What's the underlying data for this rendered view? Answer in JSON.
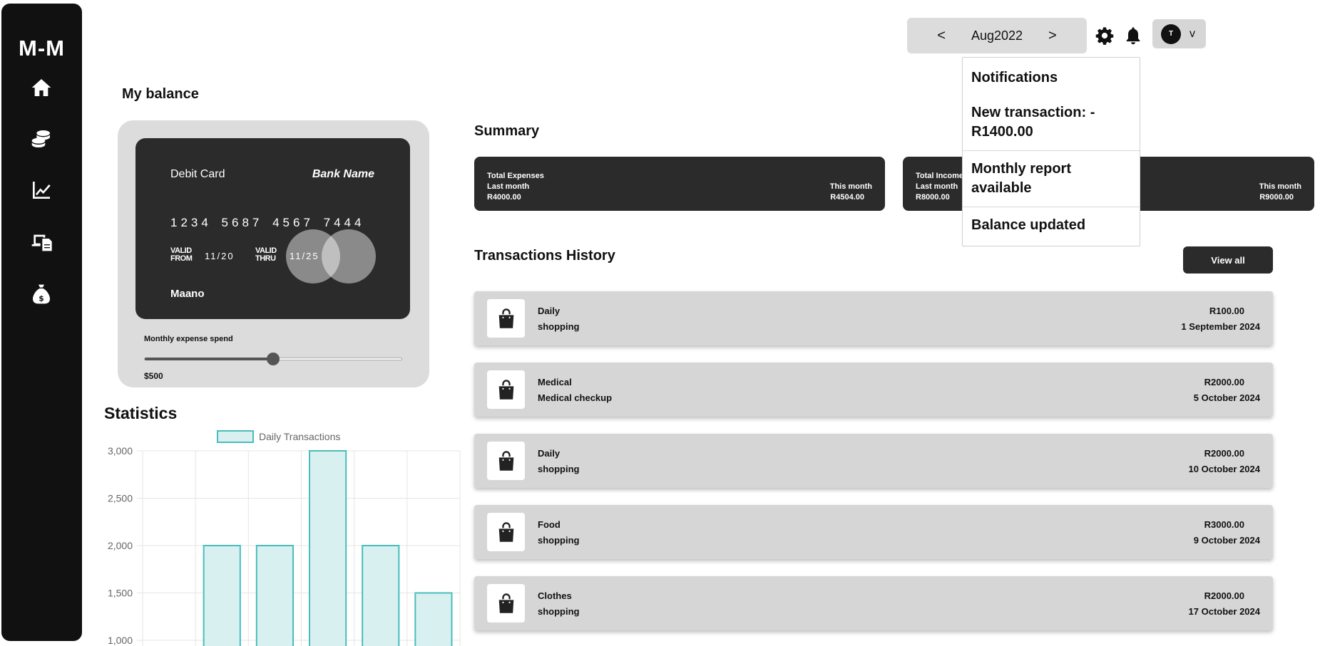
{
  "app": {
    "logo": "M-M"
  },
  "sidebar": {
    "items": [
      {
        "icon": "home-icon"
      },
      {
        "icon": "coins-icon"
      },
      {
        "icon": "chart-line-icon"
      },
      {
        "icon": "devices-icon"
      },
      {
        "icon": "money-bag-icon"
      }
    ]
  },
  "topbar": {
    "prev": "<",
    "month": "Aug2022",
    "next": ">",
    "avatar_initial": "T",
    "caret": "v"
  },
  "notifications": {
    "title": "Notifications",
    "items": [
      "New transaction: -R1400.00",
      "Monthly report available",
      "Balance updated"
    ]
  },
  "balance": {
    "heading": "My balance",
    "card": {
      "type": "Debit Card",
      "bank": "Bank Name",
      "number": "1234 5687 4567 7444",
      "valid_from_label_1": "VALID",
      "valid_from_label_2": "FROM",
      "valid_from": "11/20",
      "valid_thru_label_1": "VALID",
      "valid_thru_label_2": "THRU",
      "valid_thru": "11/25",
      "holder": "Maano"
    },
    "slider": {
      "label": "Monthly expense spend",
      "value_text": "$500",
      "fraction": 0.5
    }
  },
  "statistics": {
    "heading": "Statistics"
  },
  "summary": {
    "heading": "Summary",
    "cards": [
      {
        "title": "Total Expenses",
        "last_label": "Last month",
        "last_value": "R4000.00",
        "this_label": "This month",
        "this_value": "R4504.00"
      },
      {
        "title": "Total Income",
        "last_label": "Last month",
        "last_value": "R8000.00",
        "this_label": "This month",
        "this_value": "R9000.00"
      }
    ]
  },
  "transactions": {
    "heading": "Transactions History",
    "view_all": "View all",
    "items": [
      {
        "name": "Daily",
        "sub": "shopping",
        "amount": "R100.00",
        "date": "1 September 2024"
      },
      {
        "name": "Medical",
        "sub": "Medical checkup",
        "amount": "R2000.00",
        "date": "5 October 2024"
      },
      {
        "name": "Daily",
        "sub": "shopping",
        "amount": "R2000.00",
        "date": "10 October 2024"
      },
      {
        "name": "Food",
        "sub": "shopping",
        "amount": "R3000.00",
        "date": "9 October 2024"
      },
      {
        "name": "Clothes",
        "sub": "shopping",
        "amount": "R2000.00",
        "date": "17 October 2024"
      }
    ]
  },
  "chart_data": {
    "type": "bar",
    "series": [
      {
        "name": "Daily Transactions",
        "values": [
          0,
          2000,
          2000,
          3000,
          2000,
          1500
        ]
      }
    ],
    "categories": [
      "",
      "",
      "",
      "",
      "",
      ""
    ],
    "yticks": [
      "3,000",
      "2,500",
      "2,000",
      "1,500",
      "1,000"
    ],
    "ylim": [
      1000,
      3000
    ],
    "grid": true,
    "legend_position": "top",
    "colors": {
      "fill": "#d8f0f0",
      "stroke": "#4bbcbc"
    }
  }
}
